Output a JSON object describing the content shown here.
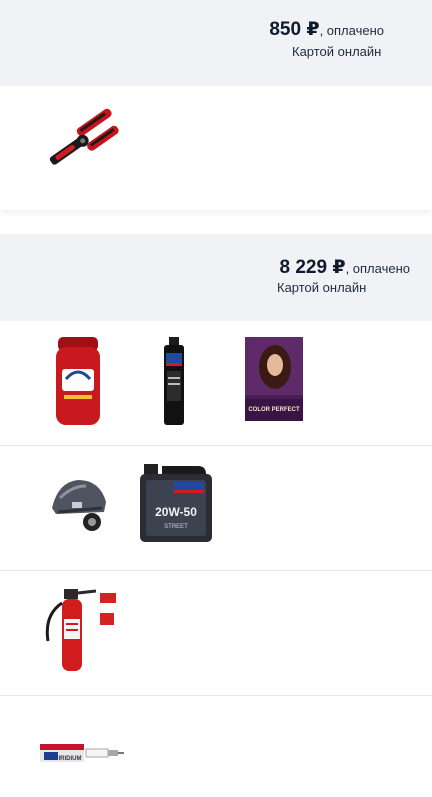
{
  "orders": [
    {
      "amount": "850 ₽",
      "paid_suffix": ", оплачено",
      "payment_method": "Картой онлайн",
      "products": [
        {
          "name": "wire-stripper-pliers-image"
        }
      ]
    },
    {
      "amount": "8 229 ₽",
      "paid_suffix": ", оплачено",
      "payment_method": "Картой онлайн",
      "products": [
        {
          "name": "old-spice-deodorant-image"
        },
        {
          "name": "liqui-moly-oil-bottle-image"
        },
        {
          "name": "hair-color-box-image",
          "label": "COLOR PERFECT"
        },
        {
          "name": "motorcycle-cover-image"
        },
        {
          "name": "liqui-moly-oil-canister-image",
          "label": "20W-50",
          "sublabel": "STREET"
        },
        {
          "name": "fire-extinguisher-image"
        },
        {
          "name": "spark-plug-image",
          "label": "IRIDIUM"
        }
      ]
    }
  ],
  "colors": {
    "header_bg": "#f0f2f5",
    "text_primary": "#0f1b2d",
    "divider": "#e6e8ec"
  }
}
